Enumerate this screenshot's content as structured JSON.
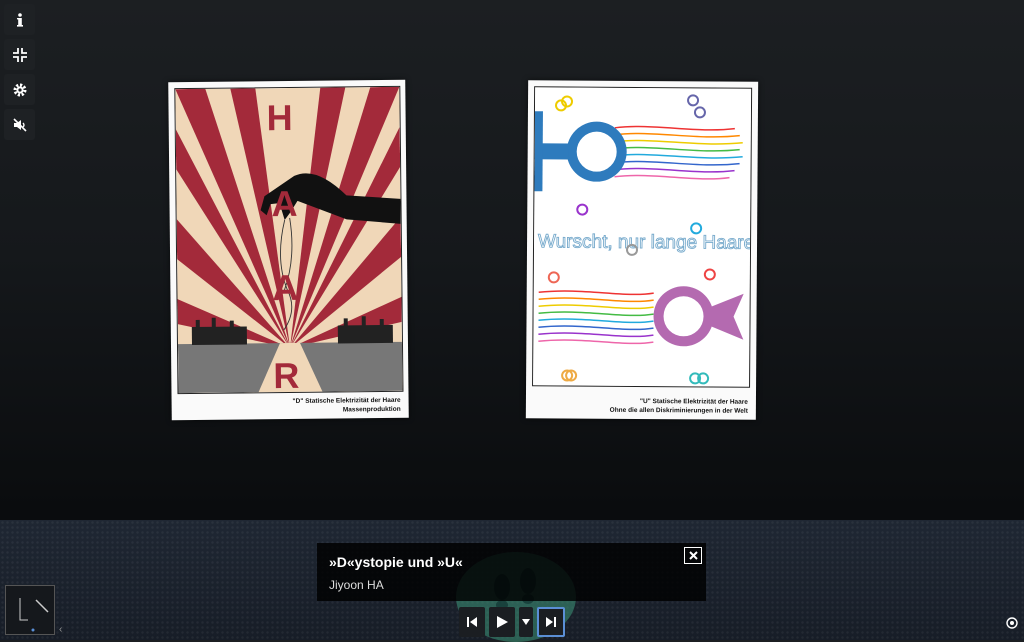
{
  "toolbar": {
    "items": [
      {
        "name": "info",
        "icon": "info-icon"
      },
      {
        "name": "fullscreen-exit",
        "icon": "compress-icon"
      },
      {
        "name": "settings",
        "icon": "gear-icon"
      },
      {
        "name": "sound",
        "icon": "mute-icon"
      }
    ]
  },
  "posters": [
    {
      "art_text": "HAAR",
      "caption_line1": "\"D\" Statische Elektrizität der Haare",
      "caption_line2": "Massenproduktion"
    },
    {
      "art_text": "Wurscht, nur lange Haare",
      "caption_line1": "\"U\" Statische Elektrizität der Haare",
      "caption_line2": "Ohne die allen Diskriminierungen in der Welt"
    }
  ],
  "info_panel": {
    "title": "»D«ystopie und »U«",
    "artist": "Jiyoon HA"
  },
  "playback": {
    "buttons": [
      "previous-icon",
      "play-icon",
      "dropdown-icon",
      "next-icon"
    ]
  },
  "colors": {
    "accent": "#5b8fd6",
    "poster_red": "#a32a3a",
    "poster_cream": "#f0d7b8"
  }
}
